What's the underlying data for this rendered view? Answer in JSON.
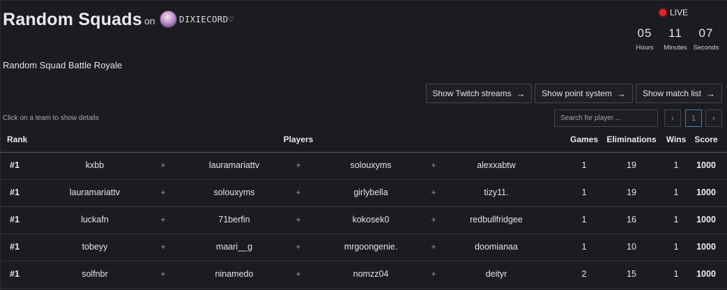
{
  "header": {
    "title": "Random Squads",
    "on_text": "on",
    "host_name": "DIXIECORD♡",
    "live_label": "LIVE",
    "countdown": [
      {
        "value": "05",
        "label": "Hours"
      },
      {
        "value": "11",
        "label": "Minutes"
      },
      {
        "value": "07",
        "label": "Seconds"
      }
    ],
    "subtitle": "Random Squad Battle Royale"
  },
  "actions": {
    "twitch_label": "Show Twitch streams",
    "points_label": "Show point system",
    "matches_label": "Show match list",
    "arrow_glyph": "→"
  },
  "toolbar": {
    "hint": "Click on a team to show details",
    "search_placeholder": "Search for player ...",
    "prev_glyph": "‹",
    "page": "1",
    "next_glyph": "›"
  },
  "table": {
    "headers": {
      "rank": "Rank",
      "players": "Players",
      "games": "Games",
      "eliminations": "Eliminations",
      "wins": "Wins",
      "score": "Score"
    },
    "plus_glyph": "+",
    "rows": [
      {
        "rank": "#1",
        "players": [
          "kxbb",
          "lauramariattv",
          "solouxyms",
          "alexxabtw"
        ],
        "games": "1",
        "eliminations": "19",
        "wins": "1",
        "score": "1000"
      },
      {
        "rank": "#1",
        "players": [
          "lauramariattv",
          "solouxyms",
          "girlybella",
          "tizy11."
        ],
        "games": "1",
        "eliminations": "19",
        "wins": "1",
        "score": "1000"
      },
      {
        "rank": "#1",
        "players": [
          "luckafn",
          "71berfin",
          "kokosek0",
          "redbullfridgee"
        ],
        "games": "1",
        "eliminations": "16",
        "wins": "1",
        "score": "1000"
      },
      {
        "rank": "#1",
        "players": [
          "tobeyy",
          "maari__g",
          "mrgoongenie.",
          "doomianaa"
        ],
        "games": "1",
        "eliminations": "10",
        "wins": "1",
        "score": "1000"
      },
      {
        "rank": "#1",
        "players": [
          "solfnbr",
          "ninamedo",
          "nomzz04",
          "deityr"
        ],
        "games": "2",
        "eliminations": "15",
        "wins": "1",
        "score": "1000"
      }
    ]
  },
  "colors": {
    "background": "#1b1c1f",
    "live_dot": "#e3262b",
    "active_page": "#3d7fd9"
  }
}
